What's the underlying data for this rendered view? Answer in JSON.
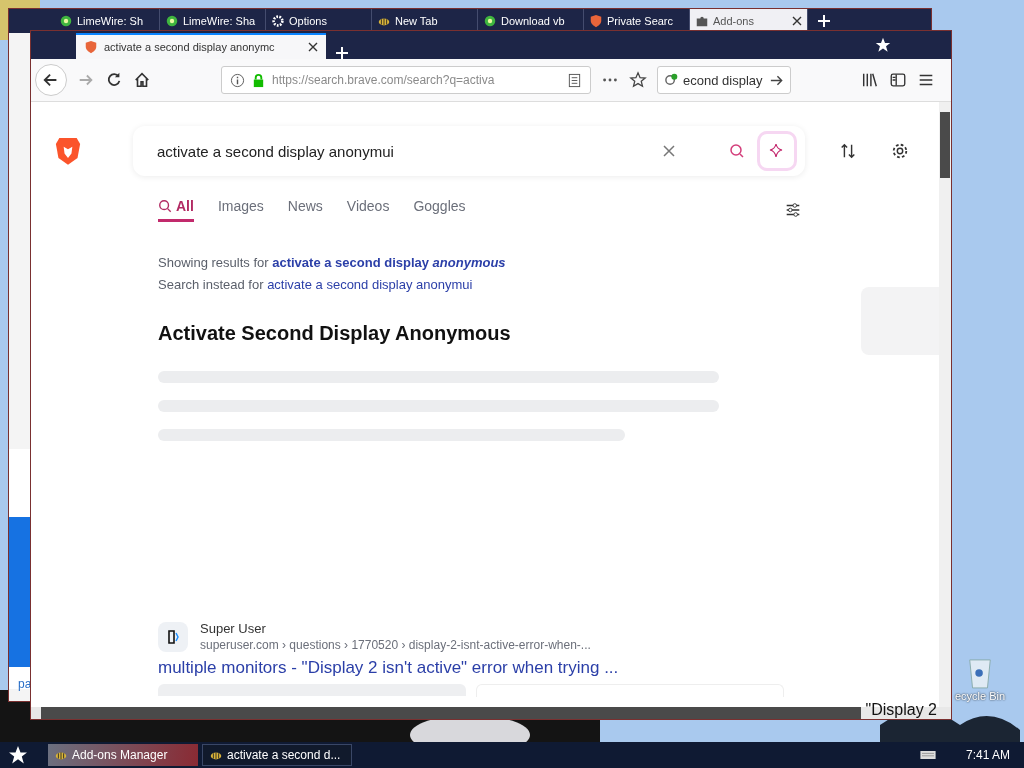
{
  "back_window": {
    "tabs": [
      {
        "label": "LimeWire: Sh",
        "selected": false
      },
      {
        "label": "LimeWire: Sha",
        "selected": false
      },
      {
        "label": "Options",
        "selected": false
      },
      {
        "label": "New Tab",
        "selected": false
      },
      {
        "label": "Download vb",
        "selected": false
      },
      {
        "label": "Private Searc",
        "selected": false
      },
      {
        "label": "Add-ons",
        "selected": true
      }
    ],
    "side_link": "pa"
  },
  "window": {
    "tabs": [
      {
        "label": "activate a second display anonymc",
        "selected": true
      }
    ],
    "toolbar": {
      "url_host": "https://search.brave.com",
      "url_path": "/search?q=activa",
      "search_value": "econd display"
    },
    "search": {
      "value": "activate a second display anonymui"
    },
    "nav_tabs": [
      {
        "label": "All",
        "selected": true
      },
      {
        "label": "Images",
        "selected": false
      },
      {
        "label": "News",
        "selected": false
      },
      {
        "label": "Videos",
        "selected": false
      },
      {
        "label": "Goggles",
        "selected": false
      }
    ],
    "correction": {
      "showing_prefix": "Showing results for",
      "showing_query": "activate a second display *anonymous*",
      "instead_prefix": "Search instead for",
      "instead_query": "activate a second display anonymui"
    },
    "heading": "Activate Second Display Anonymous",
    "result": {
      "site": "Super User",
      "breadcrumb": "superuser.com › questions › 1770520 › display-2-isnt-active-error-when-...",
      "title": "multiple monitors - \"Display 2 isn't active\" error when trying ..."
    },
    "side_snippet": "\"Display 2"
  },
  "desktop": {
    "icons": [
      {
        "label": "ecycle Bin"
      }
    ]
  },
  "taskbar": {
    "tasks": [
      {
        "label": "Add-ons Manager",
        "selected": false
      },
      {
        "label": "activate a second d...",
        "selected": true
      }
    ],
    "clock": "7:41 AM"
  }
}
